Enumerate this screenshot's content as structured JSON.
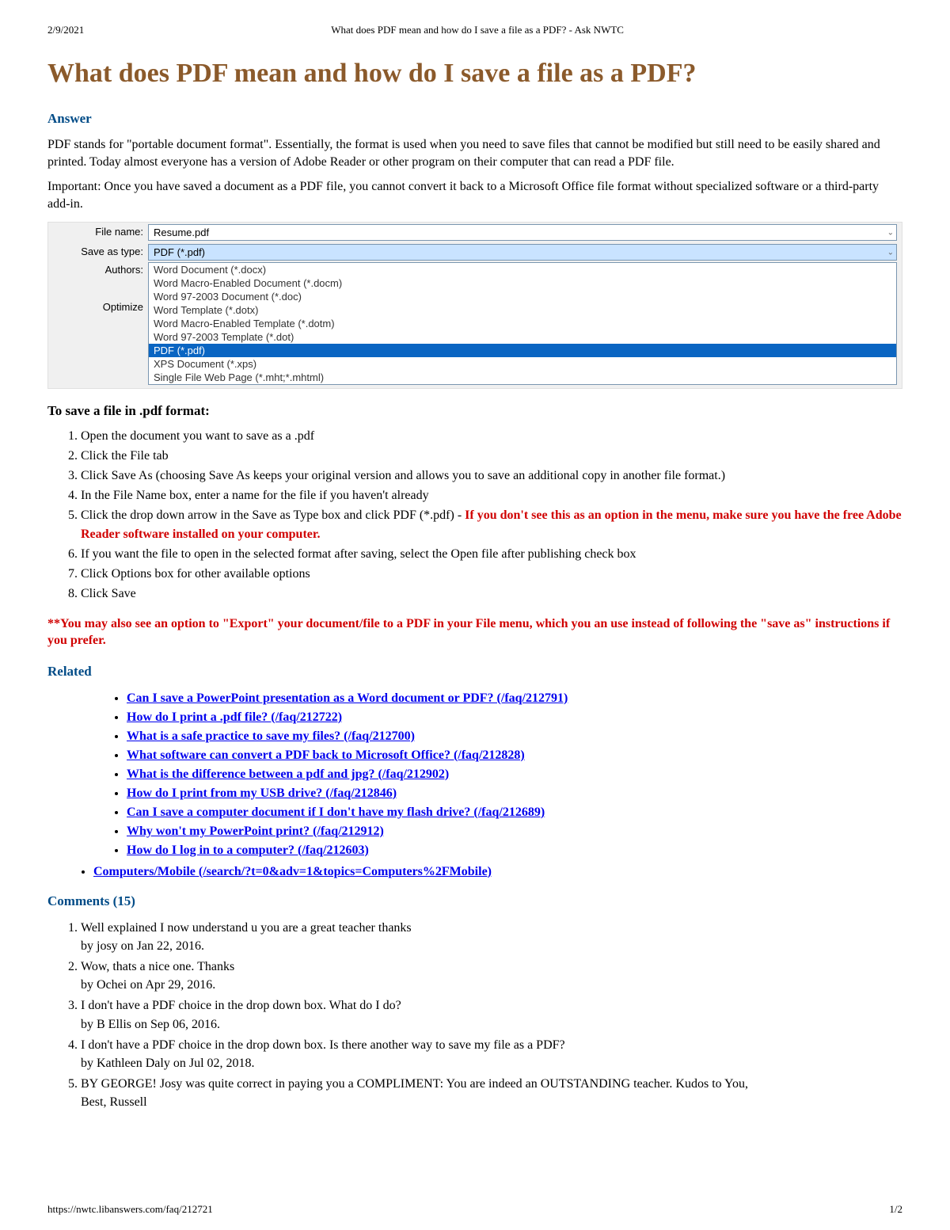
{
  "header": {
    "date": "2/9/2021",
    "page_title": "What does PDF mean and how do I save a file as a PDF? - Ask NWTC"
  },
  "title": "What does PDF mean and how do I save a file as a PDF?",
  "answer_heading": "Answer",
  "para1": "PDF stands for \"portable document format\".  Essentially, the format is used when you need to save files that cannot be modified but still need to be easily shared and printed.  Today almost everyone has a version of Adobe Reader or other program on their computer that can read a PDF file.",
  "para2": "Important:  Once you have saved a document as a PDF file, you cannot convert it back to a Microsoft Office file format without specialized software or a third-party add-in.",
  "saveas": {
    "filename_label": "File name:",
    "filename_value": "Resume.pdf",
    "type_label": "Save as type:",
    "type_value": "PDF (*.pdf)",
    "authors_label": "Authors:",
    "optimize_label": "Optimize",
    "options": [
      "Word Document (*.docx)",
      "Word Macro-Enabled Document (*.docm)",
      "Word 97-2003 Document (*.doc)",
      "Word Template (*.dotx)",
      "Word Macro-Enabled Template (*.dotm)",
      "Word 97-2003 Template (*.dot)",
      "PDF (*.pdf)",
      "XPS Document (*.xps)",
      "Single File Web Page (*.mht;*.mhtml)"
    ],
    "hl_index": 6
  },
  "steps_heading": "To save a file in .pdf format:",
  "steps": [
    {
      "text": "Open the document you want to save as a .pdf"
    },
    {
      "text": "Click the File tab"
    },
    {
      "text": "Click Save As (choosing Save As keeps your original version and allows you to save an additional copy in another file format.)"
    },
    {
      "text": "In the File Name box, enter a name for the file if you haven't already"
    },
    {
      "text": "Click the drop down arrow in the Save as Type box and click PDF (*.pdf) - ",
      "red": "If you don't see this as an option in the menu, make sure you have the free Adobe Reader software installed on your computer."
    },
    {
      "text": "If you want the file to open in the selected format after saving, select the Open file after publishing check box"
    },
    {
      "text": "Click Options box for other available options"
    },
    {
      "text": "Click Save"
    }
  ],
  "export_note": "**You may also see an option to \"Export\" your document/file to a PDF in your File menu, which you an use instead of following the \"save as\" instructions if you prefer.",
  "related_heading": "Related",
  "related": [
    "Can I save a PowerPoint presentation as a Word document or PDF? (/faq/212791)",
    "How do I print a .pdf file? (/faq/212722)",
    "What is a safe practice to save my files? (/faq/212700)",
    "What software can convert a PDF back to Microsoft Office? (/faq/212828)",
    "What is the difference between a pdf and jpg? (/faq/212902)",
    "How do I print from my USB drive? (/faq/212846)",
    "Can I save a computer document if I don't have my flash drive? (/faq/212689)",
    "Why won't my PowerPoint print? (/faq/212912)",
    "How do I log in to a computer? (/faq/212603)"
  ],
  "topic_link": "Computers/Mobile (/search/?t=0&adv=1&topics=Computers%2FMobile)",
  "comments_heading": "Comments (15)",
  "comments": [
    {
      "text": "Well explained I now understand u you are a great teacher thanks",
      "meta": "by josy on Jan 22, 2016."
    },
    {
      "text": "Wow, thats a nice one. Thanks",
      "meta": "by Ochei on Apr 29, 2016."
    },
    {
      "text": "I don't have a PDF choice in the drop down box. What do I do?",
      "meta": "by B Ellis on Sep 06, 2016."
    },
    {
      "text": "I don't have a PDF choice in the drop down box. Is there another way to save my file as a PDF?",
      "meta": "by Kathleen Daly on Jul 02, 2018."
    },
    {
      "text": "BY GEORGE! Josy was quite correct in paying you a COMPLIMENT: You are indeed an OUTSTANDING teacher. Kudos to You,",
      "extra": "Best, Russell"
    }
  ],
  "footer": {
    "url": "https://nwtc.libanswers.com/faq/212721",
    "page_num": "1/2"
  }
}
